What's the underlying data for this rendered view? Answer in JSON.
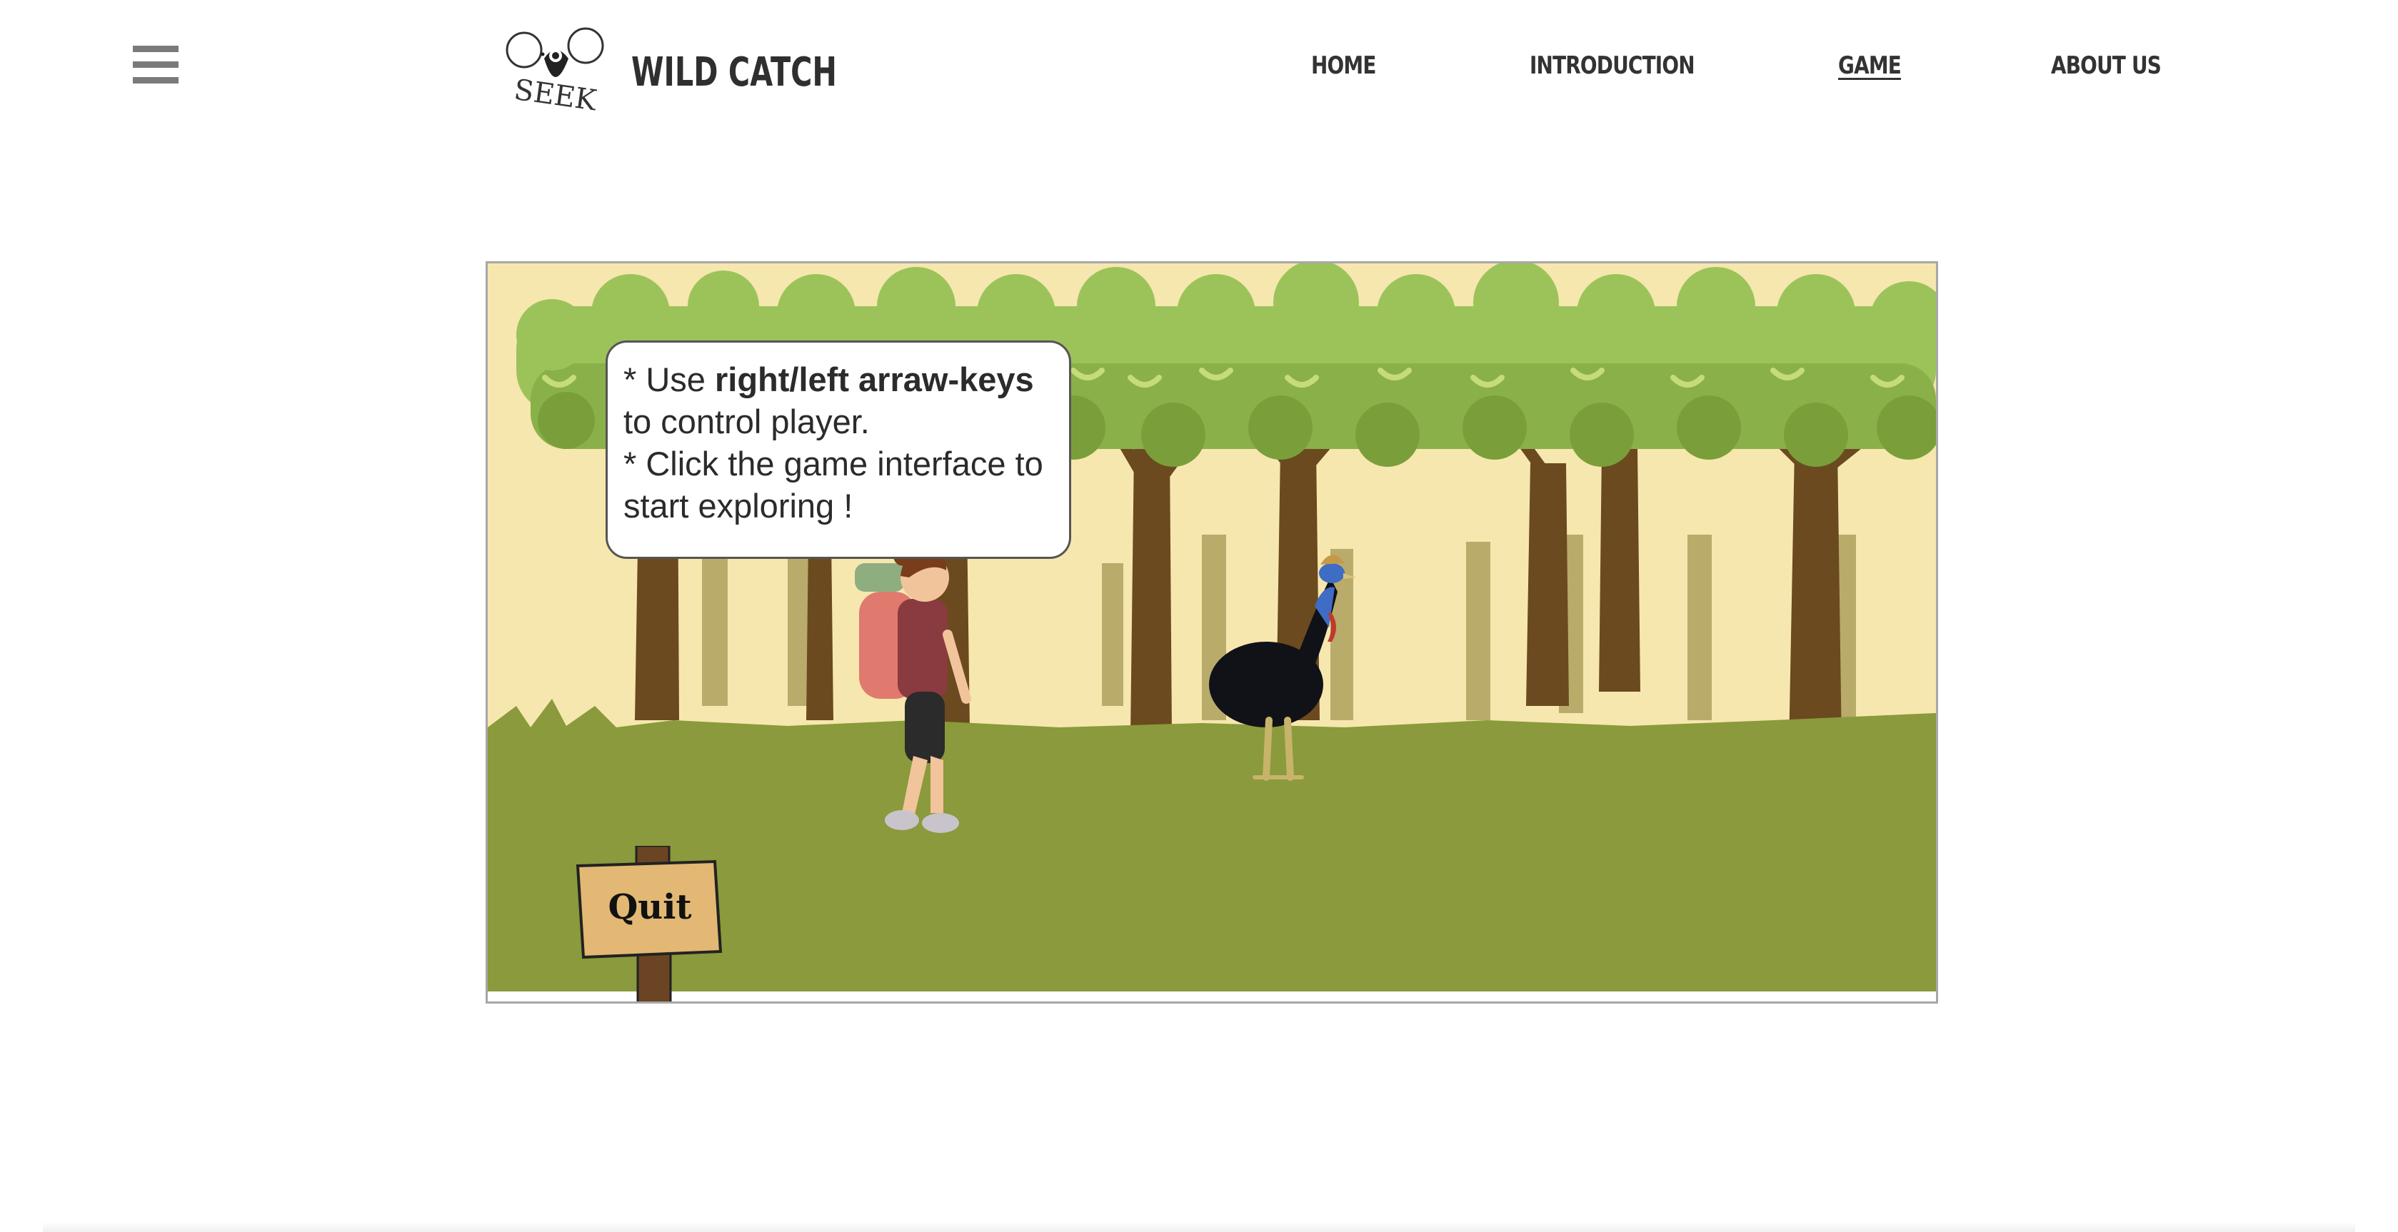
{
  "header": {
    "menu_icon": "hamburger-menu-icon",
    "logo": {
      "seek_text": "SEEK",
      "brand_text": "WILD CATCH"
    },
    "nav": [
      {
        "label": "HOME",
        "active": false
      },
      {
        "label": "INTRODUCTION",
        "active": false
      },
      {
        "label": "GAME",
        "active": true
      },
      {
        "label": "ABOUT US",
        "active": false
      }
    ]
  },
  "game": {
    "instructions": {
      "line1_prefix": "* Use ",
      "line1_bold": "right/left arraw-keys",
      "line1_suffix": " to control player.",
      "line2": "* Click the game interface to start exploring !"
    },
    "quit_label": "Quit",
    "colors": {
      "sky": "#f6e7ae",
      "grass": "#8a9a3c",
      "canopy": "#8cb94a",
      "trunk": "#6b4a1f"
    }
  }
}
